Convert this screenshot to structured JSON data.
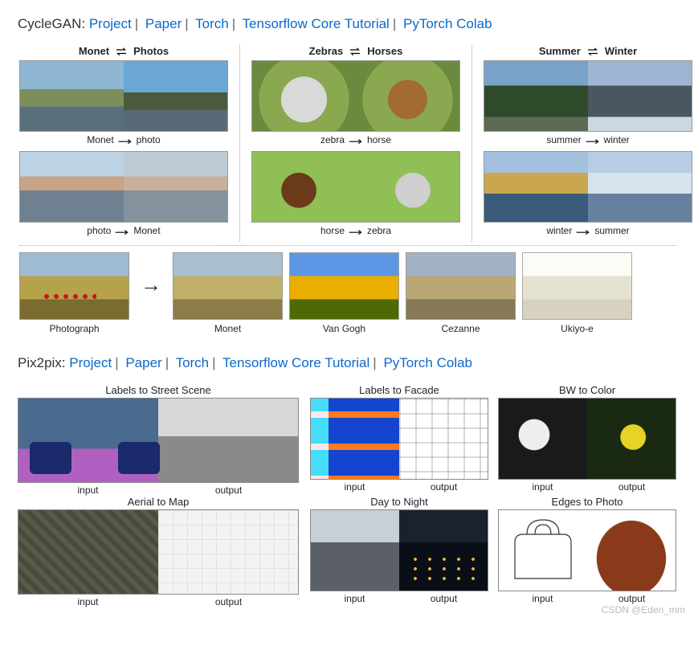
{
  "section1": {
    "name": "CycleGAN",
    "links": [
      "Project",
      "Paper",
      "Torch",
      "Tensorflow Core Tutorial",
      "PyTorch Colab"
    ]
  },
  "cg_cols": [
    {
      "head_a": "Monet",
      "head_b": "Photos",
      "cap1_a": "Monet",
      "cap1_b": "photo",
      "cap2_a": "photo",
      "cap2_b": "Monet"
    },
    {
      "head_a": "Zebras",
      "head_b": "Horses",
      "cap1_a": "zebra",
      "cap1_b": "horse",
      "cap2_a": "horse",
      "cap2_b": "zebra"
    },
    {
      "head_a": "Summer",
      "head_b": "Winter",
      "cap1_a": "summer",
      "cap1_b": "winter",
      "cap2_a": "winter",
      "cap2_b": "summer"
    }
  ],
  "style_row": {
    "src": "Photograph",
    "styles": [
      "Monet",
      "Van Gogh",
      "Cezanne",
      "Ukiyo-e"
    ]
  },
  "section2": {
    "name": "Pix2pix",
    "links": [
      "Project",
      "Paper",
      "Torch",
      "Tensorflow Core Tutorial",
      "PyTorch Colab"
    ]
  },
  "io": {
    "in": "input",
    "out": "output"
  },
  "p2p": {
    "street": "Labels to Street Scene",
    "aerial": "Aerial to Map",
    "facade": "Labels to Facade",
    "bw": "BW to Color",
    "day": "Day to Night",
    "edges": "Edges to Photo"
  },
  "watermark": "CSDN @Eden_mm"
}
